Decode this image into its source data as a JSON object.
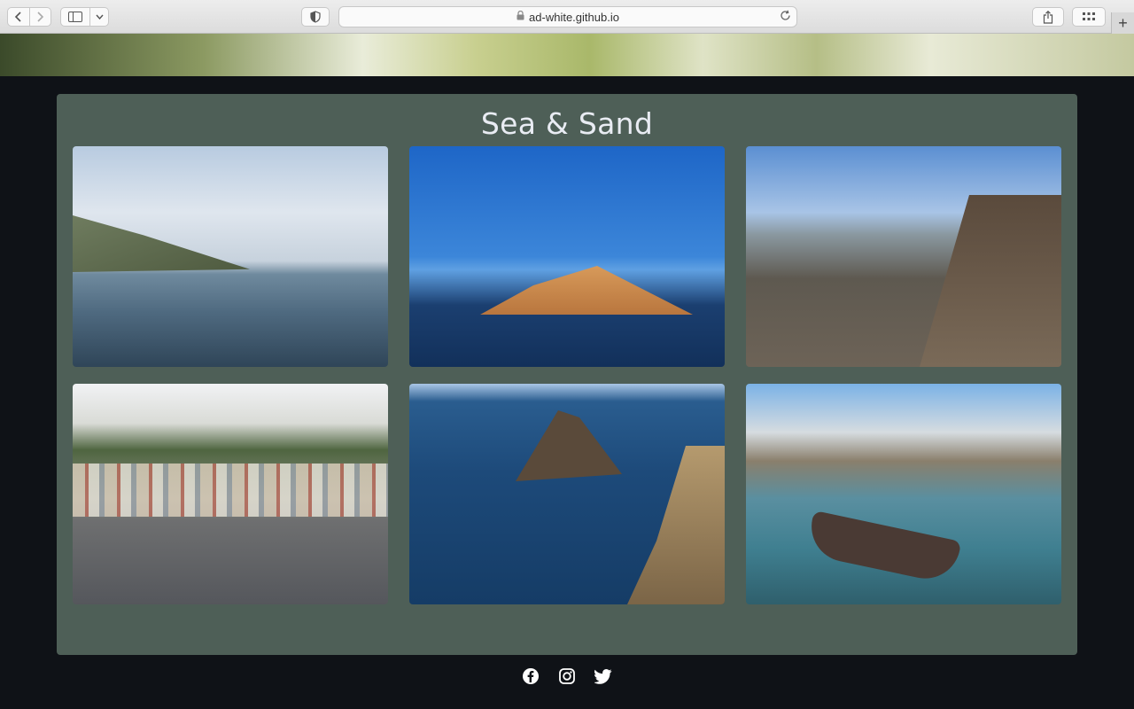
{
  "browser": {
    "url": "ad-white.github.io",
    "back_icon": "chevron-left",
    "forward_icon": "chevron-right",
    "plus_label": "+"
  },
  "main": {
    "title": "Sea & Sand",
    "photos": [
      {
        "name": "photo-cliffs-sea"
      },
      {
        "name": "photo-sandstone-cliff"
      },
      {
        "name": "photo-causeway-island"
      },
      {
        "name": "photo-harbour-town"
      },
      {
        "name": "photo-rocky-coast"
      },
      {
        "name": "photo-harbour-boats"
      }
    ]
  },
  "footer": {
    "icons": [
      "facebook-icon",
      "instagram-icon",
      "twitter-icon"
    ]
  },
  "colors": {
    "page_bg": "#0f1217",
    "card_bg": "#4e5f57",
    "title": "#e9ecf3",
    "icon": "#ffffff"
  }
}
